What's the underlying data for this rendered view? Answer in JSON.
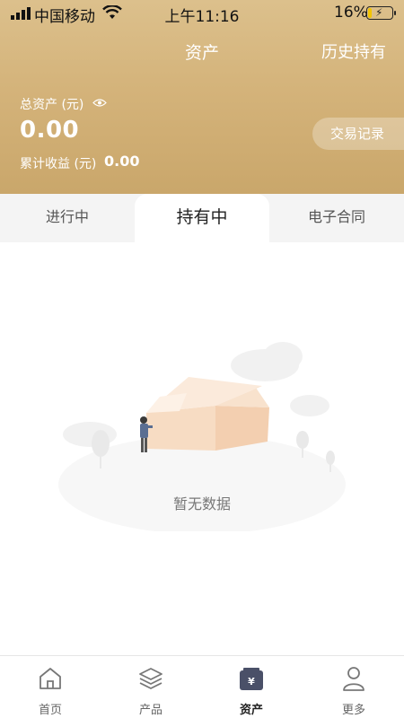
{
  "status_bar": {
    "carrier": "中国移动",
    "time": "上午11:16",
    "battery": "16%",
    "battery_level": 0.16
  },
  "header": {
    "title": "资产",
    "history_link": "历史持有"
  },
  "summary": {
    "total_assets_label": "总资产 (元)",
    "total_assets_value": "0.00",
    "cumulative_income_label": "累计收益 (元)",
    "cumulative_income_value": "0.00",
    "trade_records_button": "交易记录"
  },
  "tabs": [
    {
      "label": "进行中",
      "active": false
    },
    {
      "label": "持有中",
      "active": true
    },
    {
      "label": "电子合同",
      "active": false
    }
  ],
  "empty_state": {
    "message": "暂无数据"
  },
  "bottom_nav": [
    {
      "label": "首页",
      "icon": "home-icon",
      "active": false
    },
    {
      "label": "产品",
      "icon": "layers-icon",
      "active": false
    },
    {
      "label": "资产",
      "icon": "wallet-yen-icon",
      "active": true
    },
    {
      "label": "更多",
      "icon": "user-icon",
      "active": false
    }
  ],
  "colors": {
    "header_gold": "#d4b37a",
    "active_nav": "#4a5068"
  }
}
